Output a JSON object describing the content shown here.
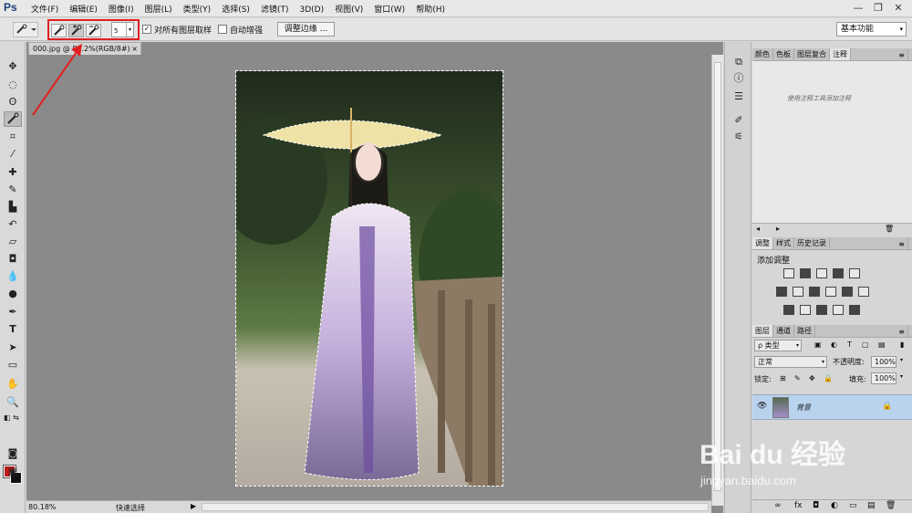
{
  "app": {
    "logo": "Ps"
  },
  "menu": [
    "文件(F)",
    "编辑(E)",
    "图像(I)",
    "图层(L)",
    "类型(Y)",
    "选择(S)",
    "滤镜(T)",
    "3D(D)",
    "视图(V)",
    "窗口(W)",
    "帮助(H)"
  ],
  "window_controls": {
    "minimize": "—",
    "restore": "❐",
    "close": "✕"
  },
  "options": {
    "brush_size": "5",
    "sample_all_layers": {
      "label": "对所有图层取样",
      "checked": true
    },
    "auto_enhance": {
      "label": "自动增强",
      "checked": false
    },
    "refine_edge_label": "调整边缘 ...",
    "workspace": "基本功能",
    "accent": "#e02020"
  },
  "document": {
    "tab_title": "000.jpg @ 80.2%(RGB/8#)",
    "tab_close": "×",
    "zoom": "80.18%",
    "status_text": "快速选择"
  },
  "panels": {
    "notes_tabs": [
      "颜色",
      "色板",
      "图层复合",
      "注释"
    ],
    "notes_active": "注释",
    "notes_hint": "使用注释工具添加注释",
    "adjust_tabs": [
      "调整",
      "样式",
      "历史记录"
    ],
    "adjust_active": "调整",
    "adjust_title": "添加调整",
    "layers_tabs": [
      "图层",
      "通道",
      "路径"
    ],
    "layers_active": "图层",
    "filter_kind": "ρ 类型",
    "blend_mode": "正常",
    "opacity_label": "不透明度:",
    "opacity_value": "100%",
    "lock_label": "锁定:",
    "fill_label": "填充:",
    "fill_value": "100%",
    "layer_name": "背景"
  },
  "watermark": {
    "brand": "Bai du 经验",
    "url": "jingyan.baidu.com"
  },
  "colors": {
    "foreground": "#b81c1c",
    "background": "#111111",
    "selected_layer": "#b9d3ef"
  }
}
